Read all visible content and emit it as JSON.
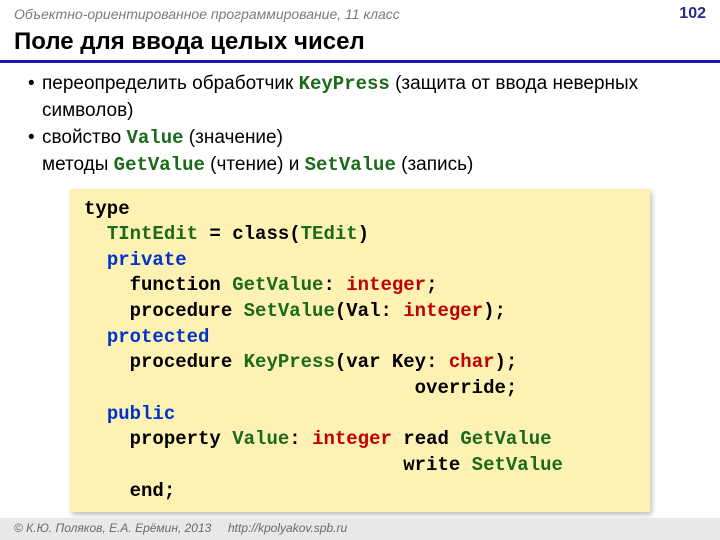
{
  "header": {
    "course": "Объектно-ориентированное программирование, 11 класс",
    "page": "102"
  },
  "title": "Поле для ввода целых чисел",
  "bullets": {
    "b1_pre": "переопределить обработчик ",
    "b1_key": "KeyPress",
    "b1_post": " (защита от ввода неверных символов)",
    "b2_pre": "свойство ",
    "b2_key": "Value",
    "b2_post": " (значение)",
    "b2_line2_a": "методы ",
    "b2_line2_k1": "GetValue",
    "b2_line2_b": " (чтение) и ",
    "b2_line2_k2": "SetValue",
    "b2_line2_c": " (запись)"
  },
  "code": {
    "l01a": "type",
    "l02a": "  ",
    "l02b": "TIntEdit",
    "l02c": " = class(",
    "l02d": "TEdit",
    "l02e": ")",
    "l03a": "  ",
    "l03b": "private",
    "l04a": "    function ",
    "l04b": "GetValue",
    "l04c": ": ",
    "l04d": "integer",
    "l04e": ";",
    "l05a": "    procedure ",
    "l05b": "SetValue",
    "l05c": "(Val: ",
    "l05d": "integer",
    "l05e": ");",
    "l06a": "  ",
    "l06b": "protected",
    "l07a": "    procedure ",
    "l07b": "KeyPress",
    "l07c": "(var Key: ",
    "l07d": "char",
    "l07e": ");",
    "l08a": "                             override;",
    "l09a": "  ",
    "l09b": "public",
    "l10a": "    property ",
    "l10b": "Value",
    "l10c": ": ",
    "l10d": "integer",
    "l10e": " read ",
    "l10f": "GetValue",
    "l11a": "                            write ",
    "l11b": "SetValue",
    "l12a": "    end;"
  },
  "footer": {
    "copyright": "© К.Ю. Поляков, Е.А. Ерёмин, 2013",
    "url": "http://kpolyakov.spb.ru"
  }
}
